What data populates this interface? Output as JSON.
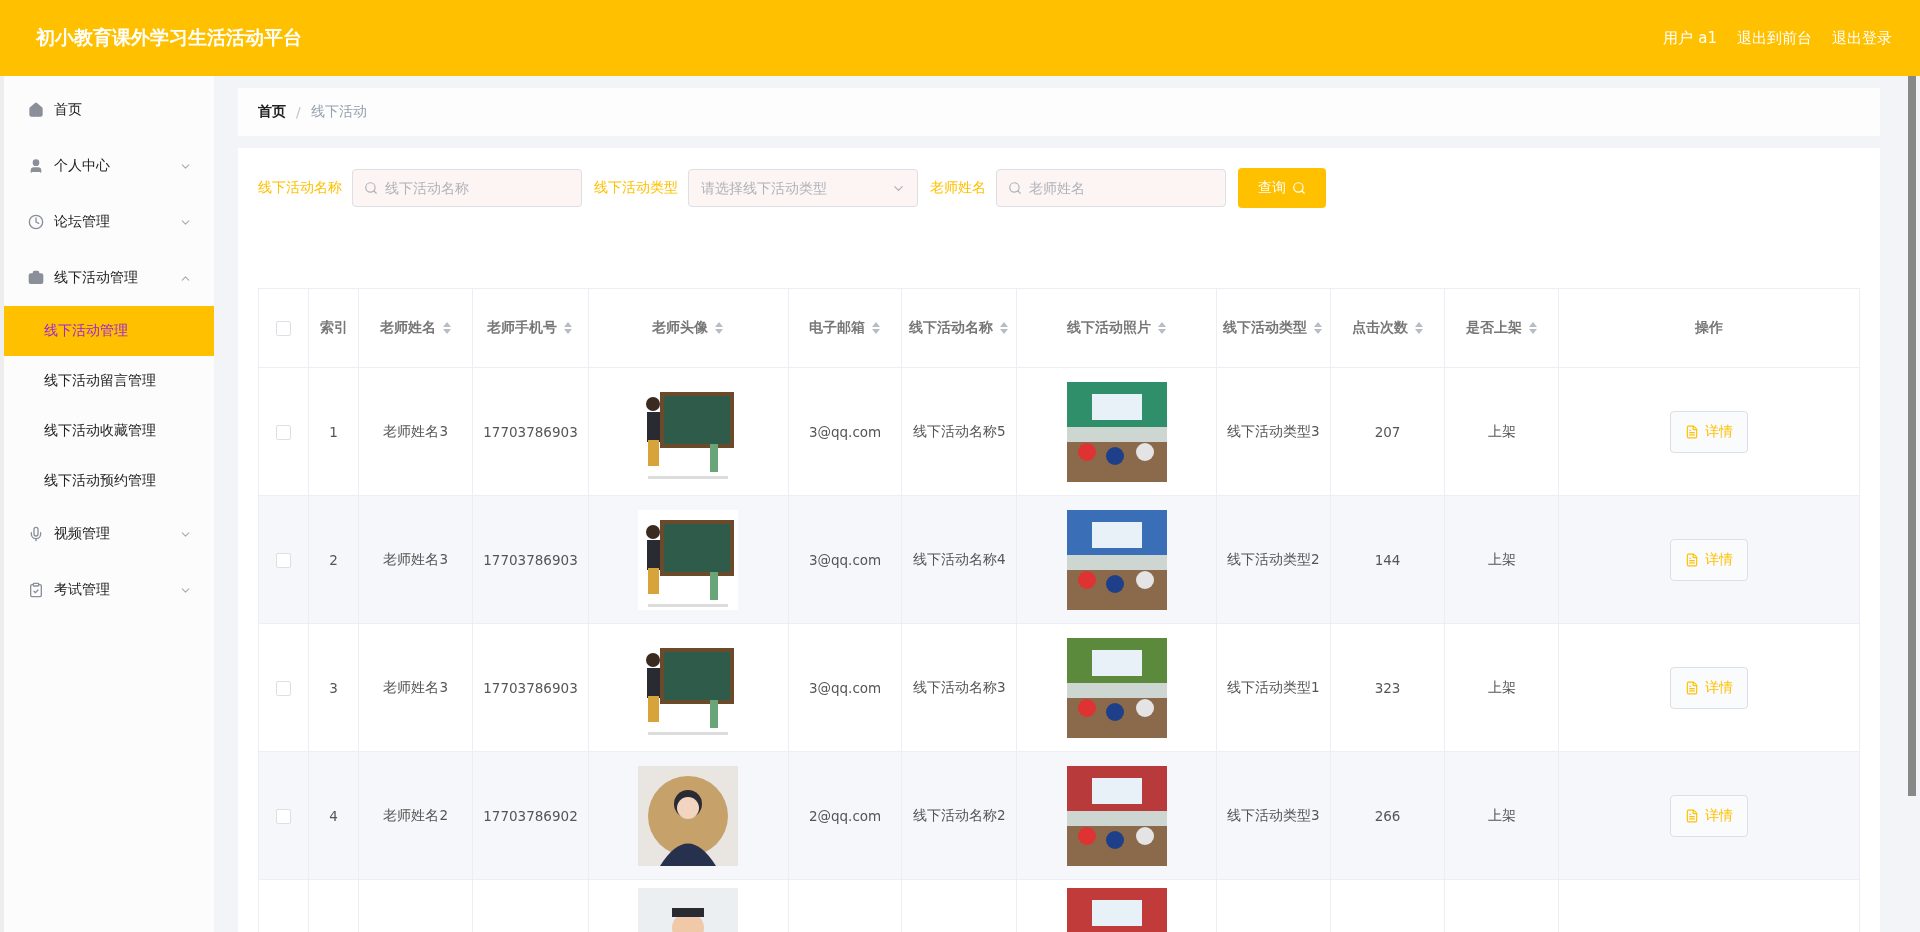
{
  "header": {
    "title": "初小教育课外学习生活活动平台",
    "links": [
      {
        "label": "用户 a1"
      },
      {
        "label": "退出到前台"
      },
      {
        "label": "退出登录"
      }
    ]
  },
  "sidebar": {
    "items": [
      {
        "label": "首页"
      },
      {
        "label": "个人中心",
        "expanded": false
      },
      {
        "label": "论坛管理",
        "expanded": false
      },
      {
        "label": "线下活动管理",
        "expanded": true,
        "children": [
          {
            "label": "线下活动管理",
            "selected": true
          },
          {
            "label": "线下活动留言管理",
            "selected": false
          },
          {
            "label": "线下活动收藏管理",
            "selected": false
          },
          {
            "label": "线下活动预约管理",
            "selected": false
          }
        ]
      },
      {
        "label": "视频管理",
        "expanded": false
      },
      {
        "label": "考试管理",
        "expanded": false
      }
    ]
  },
  "breadcrumb": {
    "separator": "/",
    "items": [
      {
        "label": "首页"
      },
      {
        "label": "线下活动"
      }
    ]
  },
  "search": {
    "fields": [
      {
        "kind": "input",
        "label": "线下活动名称",
        "placeholder": "线下活动名称"
      },
      {
        "kind": "select",
        "label": "线下活动类型",
        "placeholder": "请选择线下活动类型"
      },
      {
        "kind": "input",
        "label": "老师姓名",
        "placeholder": "老师姓名"
      }
    ],
    "button": "查询"
  },
  "table": {
    "select_all": {
      "checked": false
    },
    "columns": [
      {
        "label": "索引",
        "sortable": false
      },
      {
        "label": "老师姓名",
        "sortable": true
      },
      {
        "label": "老师手机号",
        "sortable": true
      },
      {
        "label": "老师头像",
        "sortable": true
      },
      {
        "label": "电子邮箱",
        "sortable": true
      },
      {
        "label": "线下活动名称",
        "sortable": true
      },
      {
        "label": "线下活动照片",
        "sortable": true
      },
      {
        "label": "线下活动类型",
        "sortable": true
      },
      {
        "label": "点击次数",
        "sortable": true
      },
      {
        "label": "是否上架",
        "sortable": true
      },
      {
        "label": "操作",
        "sortable": false
      }
    ],
    "rows": [
      {
        "kind": "full",
        "checked": false,
        "index": "1",
        "name": "老师姓名3",
        "phone": "17703786903",
        "email": "3@qq.com",
        "activity": "线下活动名称5",
        "type": "线下活动类型3",
        "clicks": "207",
        "status": "上架",
        "action": "详情"
      },
      {
        "kind": "full",
        "checked": false,
        "index": "2",
        "name": "老师姓名3",
        "phone": "17703786903",
        "email": "3@qq.com",
        "activity": "线下活动名称4",
        "type": "线下活动类型2",
        "clicks": "144",
        "status": "上架",
        "action": "详情"
      },
      {
        "kind": "full",
        "checked": false,
        "index": "3",
        "name": "老师姓名3",
        "phone": "17703786903",
        "email": "3@qq.com",
        "activity": "线下活动名称3",
        "type": "线下活动类型1",
        "clicks": "323",
        "status": "上架",
        "action": "详情"
      },
      {
        "kind": "full",
        "checked": false,
        "index": "4",
        "name": "老师姓名2",
        "phone": "17703786902",
        "email": "2@qq.com",
        "activity": "线下活动名称2",
        "type": "线下活动类型3",
        "clicks": "266",
        "status": "上架",
        "action": "详情"
      },
      {
        "kind": "partial"
      }
    ]
  }
}
